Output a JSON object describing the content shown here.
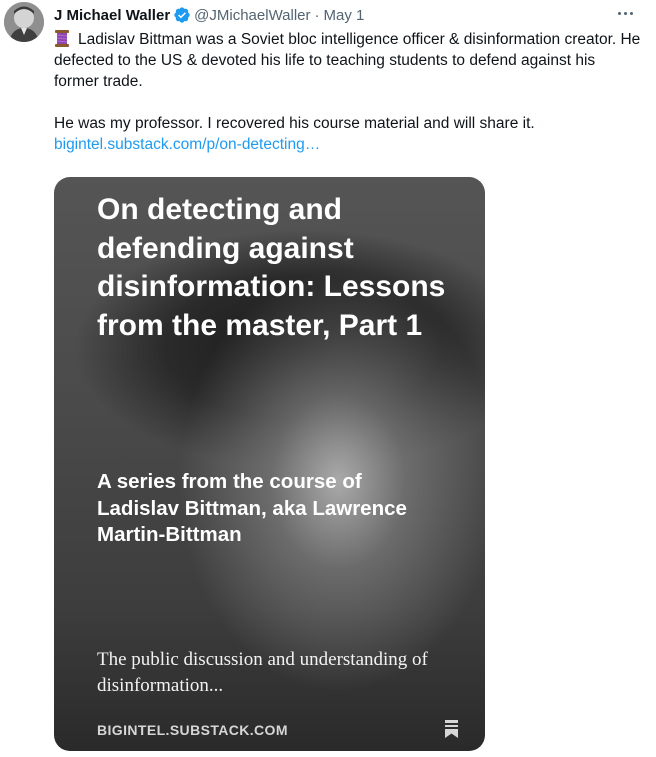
{
  "author": {
    "name": "J Michael Waller",
    "handle": "@JMichaelWaller",
    "separator": "·",
    "date": "May 1",
    "verified": true
  },
  "icons": {
    "verified": "verified-badge-icon",
    "thread_emoji": "spool-of-thread-emoji",
    "more": "more-options-icon",
    "bookmark": "bookmark-icon"
  },
  "tweet": {
    "paragraph_1": "Ladislav Bittman was a Soviet bloc intelligence officer & disinformation creator. He defected to the US & devoted his life to teaching students to defend against his former trade.",
    "paragraph_2": "He was my professor. I recovered his course material and will share it.",
    "link": "bigintel.substack.com/p/on-detecting…"
  },
  "card": {
    "title": "On detecting and defending against disinformation: Lessons from the master, Part 1",
    "subtitle": "A series from the course of Ladislav Bittman, aka Lawrence Martin-Bittman",
    "excerpt": "The public discussion and understanding of disinformation...",
    "domain": "BIGINTEL.SUBSTACK.COM"
  },
  "colors": {
    "text_primary": "#0f1419",
    "text_secondary": "#536471",
    "link": "#1d9bf0",
    "verified": "#1d9bf0"
  }
}
